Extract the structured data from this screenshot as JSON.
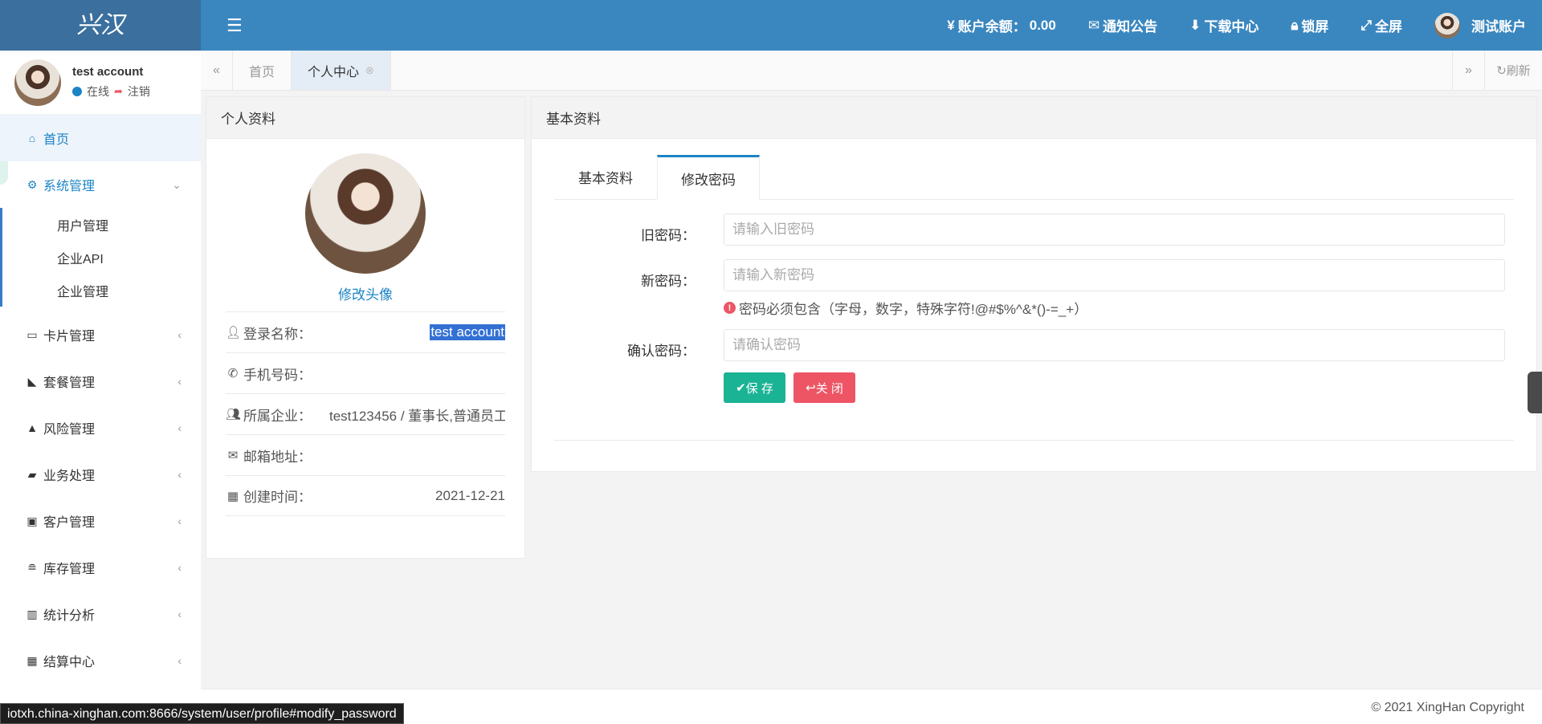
{
  "logo": "兴汉",
  "header": {
    "balance_label": "账户余额：",
    "balance_value": "0.00",
    "notice": "通知公告",
    "download": "下载中心",
    "lock": "锁屏",
    "fullscreen": "全屏",
    "user": "测试账户"
  },
  "user_panel": {
    "name": "test account",
    "online": "在线",
    "logout": "注销"
  },
  "sidebar": {
    "home": "首页",
    "system": "系统管理",
    "sub_items": [
      "用户管理",
      "企业API",
      "企业管理"
    ],
    "items": [
      "卡片管理",
      "套餐管理",
      "风险管理",
      "业务处理",
      "客户管理",
      "库存管理",
      "统计分析",
      "结算中心"
    ]
  },
  "tabs": {
    "home": "首页",
    "profile": "个人中心",
    "refresh": "刷新"
  },
  "profile": {
    "title": "个人资料",
    "change_avatar": "修改头像",
    "rows": [
      {
        "label": "登录名称：",
        "value": "test account"
      },
      {
        "label": "手机号码：",
        "value": ""
      },
      {
        "label": "所属企业：",
        "value": "test123456 / 董事长,普通员工"
      },
      {
        "label": "邮箱地址：",
        "value": ""
      },
      {
        "label": "创建时间：",
        "value": "2021-12-21"
      }
    ]
  },
  "basic": {
    "title": "基本资料",
    "tab_basic": "基本资料",
    "tab_password": "修改密码",
    "old_label": "旧密码：",
    "old_placeholder": "请输入旧密码",
    "new_label": "新密码：",
    "new_placeholder": "请输入新密码",
    "hint": "密码必须包含（字母，数字，特殊字符!@#$%^&*()-=_+）",
    "confirm_label": "确认密码：",
    "confirm_placeholder": "请确认密码",
    "save": "保 存",
    "close": "关 闭"
  },
  "footer": {
    "copyright": "© 2021 XingHan Copyright"
  },
  "status_url": "iotxh.china-xinghan.com:8666/system/user/profile#modify_password"
}
